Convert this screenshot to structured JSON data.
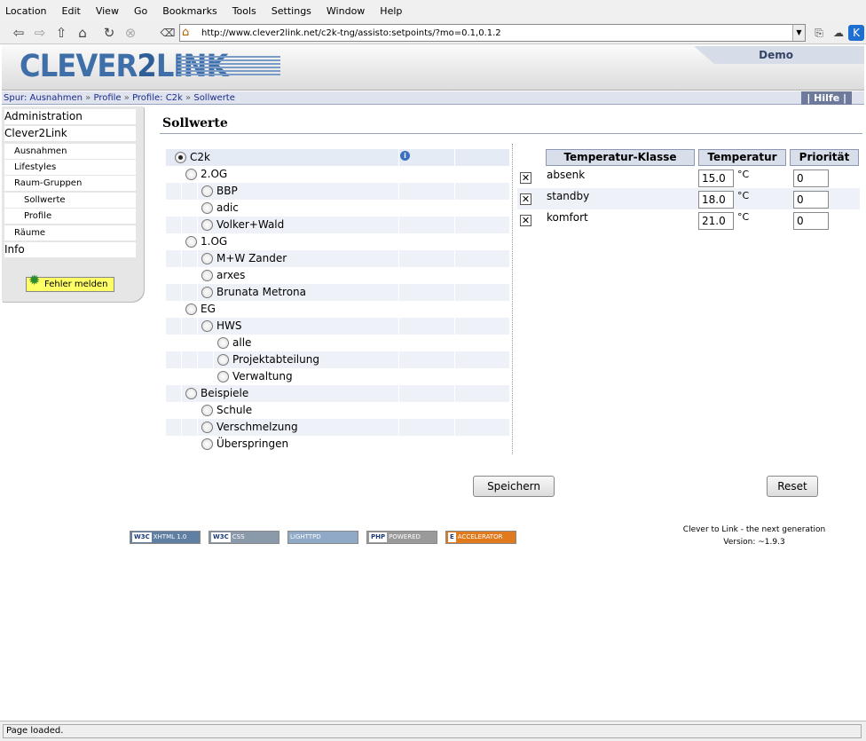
{
  "menu": [
    "Location",
    "Edit",
    "View",
    "Go",
    "Bookmarks",
    "Tools",
    "Settings",
    "Window",
    "Help"
  ],
  "url": "http://www.clever2link.net/c2k-tng/assisto:setpoints/?mo=0.1,0.1.2",
  "logo": {
    "part1": "CLEVER",
    "part2": "2",
    "part3": "LINK"
  },
  "demo_label": "Demo",
  "breadcrumb": {
    "prefix": "Spur:",
    "items": [
      "Ausnahmen",
      "Profile",
      "Profile: C2k",
      "Sollwerte"
    ],
    "sep": "»",
    "help": "| Hilfe |"
  },
  "sidebar": [
    {
      "label": "Administration",
      "level": 0
    },
    {
      "label": "Clever2Link",
      "level": 0
    },
    {
      "label": "Ausnahmen",
      "level": 1
    },
    {
      "label": "Lifestyles",
      "level": 1
    },
    {
      "label": "Raum-Gruppen",
      "level": 1
    },
    {
      "label": "Sollwerte",
      "level": 2
    },
    {
      "label": "Profile",
      "level": 2
    },
    {
      "label": "Räume",
      "level": 1
    },
    {
      "label": "Info",
      "level": 0
    }
  ],
  "bug_button": "Fehler melden",
  "page_title": "Sollwerte",
  "tree": [
    {
      "label": "C2k",
      "level": 0,
      "checked": true
    },
    {
      "label": "2.OG",
      "level": 1
    },
    {
      "label": "BBP",
      "level": 2
    },
    {
      "label": "adic",
      "level": 2
    },
    {
      "label": "Volker+Wald",
      "level": 2
    },
    {
      "label": "1.OG",
      "level": 1
    },
    {
      "label": "M+W Zander",
      "level": 2
    },
    {
      "label": "arxes",
      "level": 2
    },
    {
      "label": "Brunata Metrona",
      "level": 2
    },
    {
      "label": "EG",
      "level": 1
    },
    {
      "label": "HWS",
      "level": 2
    },
    {
      "label": "alle",
      "level": 3
    },
    {
      "label": "Projektabteilung",
      "level": 3
    },
    {
      "label": "Verwaltung",
      "level": 3
    },
    {
      "label": "Beispiele",
      "level": 1
    },
    {
      "label": "Schule",
      "level": 2
    },
    {
      "label": "Verschmelzung",
      "level": 2
    },
    {
      "label": "Überspringen",
      "level": 2
    }
  ],
  "table": {
    "headers": [
      "Temperatur-Klasse",
      "Temperatur",
      "Priorität"
    ],
    "rows": [
      {
        "name": "absenk",
        "temp": "15.0",
        "unit": "°C",
        "prio": "0"
      },
      {
        "name": "standby",
        "temp": "18.0",
        "unit": "°C",
        "prio": "0"
      },
      {
        "name": "komfort",
        "temp": "21.0",
        "unit": "°C",
        "prio": "0"
      }
    ]
  },
  "buttons": {
    "save": "Speichern",
    "reset": "Reset"
  },
  "badges": [
    {
      "left": "W3C",
      "right": "XHTML 1.0",
      "color": "#5f7fa3"
    },
    {
      "left": "W3C",
      "right": "CSS",
      "color": "#8a9aaa"
    },
    {
      "left": "",
      "right": "LIGHTTPD",
      "color": "#8fa9c7"
    },
    {
      "left": "PHP",
      "right": "POWERED",
      "color": "#9a9a9a"
    },
    {
      "left": "E",
      "right": "ACCELERATOR",
      "color": "#e07a1c"
    }
  ],
  "footer": {
    "line1": "Clever to Link - the next generation",
    "line2": "Version: ~1.9.3"
  },
  "status": "Page loaded."
}
